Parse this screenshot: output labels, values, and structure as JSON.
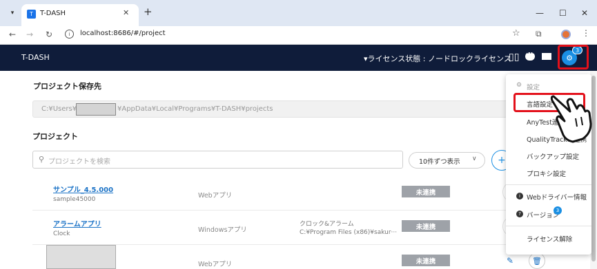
{
  "browser": {
    "tab_title": "T-DASH",
    "tab_favicon": "T",
    "url": "localhost:8686/#/project",
    "icons": {
      "tab_list": "chevron-down-icon",
      "close": "close-icon",
      "new_tab": "plus-icon",
      "back": "arrow-left-icon",
      "forward": "arrow-right-icon",
      "reload": "reload-icon",
      "bookmark": "star-icon",
      "extensions": "puzzle-icon",
      "menu": "kebab-icon"
    }
  },
  "app": {
    "title": "T-DASH",
    "license_status": "▾ライセンス状態 : ノードロックライセンス",
    "settings_badge": "3",
    "header_bg": "#0f1c3a",
    "accent": "#1a8fe3"
  },
  "main": {
    "save_location_label": "プロジェクト保存先",
    "save_path_prefix": "C:¥Users¥",
    "save_path_suffix": "¥AppData¥Local¥Programs¥T-DASH¥projects",
    "projects_label": "プロジェクト",
    "search_placeholder": "プロジェクトを検索",
    "per_page": "10件ずつ表示",
    "projects": [
      {
        "name": "サンプル_4.5.000",
        "id": "sample45000",
        "type": "Webアプリ",
        "path": "",
        "status": "未連携"
      },
      {
        "name": "アラームアプリ",
        "id": "Clock",
        "type": "Windowsアプリ",
        "path_line1": "クロック&アラーム",
        "path_line2": "C:¥Program Files (x86)¥sakur···",
        "status": "未連携"
      },
      {
        "name": "",
        "id": "",
        "type": "Webアプリ",
        "path": "",
        "status": "未連携"
      }
    ]
  },
  "menu": {
    "header": "設定",
    "items": [
      "言語設定",
      "AnyTest連携",
      "QualityTracker連携",
      "バックアップ設定",
      "プロキシ設定"
    ],
    "webdriver_info": "Webドライバー情報",
    "version": "バージョン",
    "version_badge": "3",
    "license_release": "ライセンス解除",
    "highlight_color": "#e3101a"
  }
}
